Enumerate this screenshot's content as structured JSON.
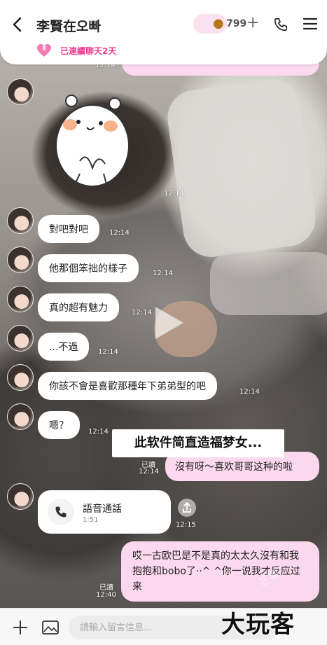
{
  "header": {
    "title": "李賢在오빠",
    "coin_count": "799",
    "coin_plus": "+",
    "streak_level": "8",
    "streak_text": "已連續聊天2天"
  },
  "messages": {
    "top_time": "12:14",
    "sticker_time": "12:14",
    "m1": {
      "text": "對吧對吧",
      "time": "12:14"
    },
    "m2": {
      "text": "他那個笨拙的樣子",
      "time": "12:14"
    },
    "m3": {
      "text": "真的超有魅力",
      "time": "12:14"
    },
    "m4": {
      "text": "...不過",
      "time": "12:14"
    },
    "m5": {
      "text": "你該不會是喜歡那種年下弟弟型的吧",
      "time": "12:14"
    },
    "m6": {
      "text": "嗯？",
      "time": "12:14"
    },
    "out1": {
      "text": "沒有呀～喜欢哥哥这种的啦",
      "read": "已讀",
      "time": "12:14"
    },
    "call": {
      "title": "語音通話",
      "duration": "1:51",
      "time": "12:15"
    },
    "out2": {
      "text": "哎一古欧巴是不是真的太太久沒有和我抱抱和bobo了··^ ^你一说我才反应过来",
      "read": "已讀",
      "time": "12:40"
    }
  },
  "promo": {
    "text": "此软件简直造福梦女..."
  },
  "input": {
    "placeholder": "請輸入留言信息..."
  },
  "watermark": {
    "text": "大玩客",
    "faint": "芒果"
  },
  "colors": {
    "accent": "#ec3f8f",
    "bubble_out": "#fbd8ee",
    "bubble_in": "#ffffff"
  }
}
